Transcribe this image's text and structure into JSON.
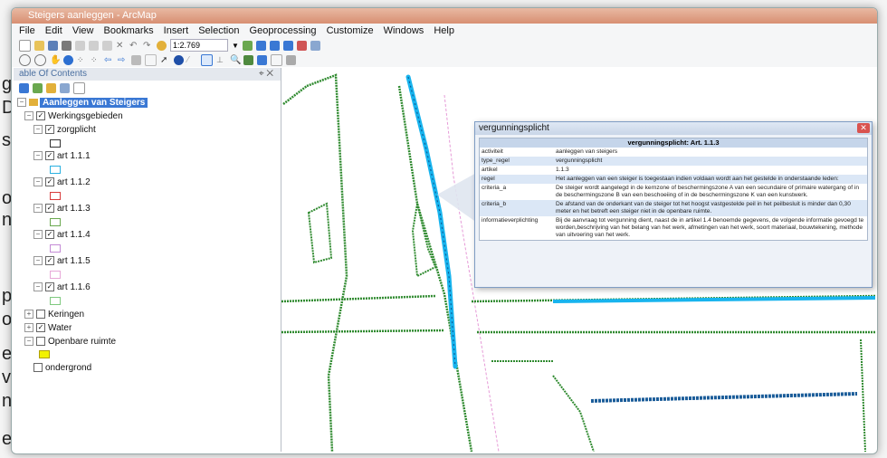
{
  "background": {
    "top_fragment": "g",
    "fragments": [
      "g",
      "Di",
      "s",
      "or",
      "n",
      "p",
      "of",
      "e",
      "v",
      "n",
      "e"
    ]
  },
  "window": {
    "title": "Steigers aanleggen - ArcMap"
  },
  "menu": [
    "File",
    "Edit",
    "View",
    "Bookmarks",
    "Insert",
    "Selection",
    "Geoprocessing",
    "Customize",
    "Windows",
    "Help"
  ],
  "toolbar": {
    "scale": "1:2.769"
  },
  "toc": {
    "title": "able Of Contents",
    "root": "Aanleggen van Steigers",
    "group": "Werkingsgebieden",
    "layers": [
      {
        "name": "zorgplicht",
        "color": "#333333"
      },
      {
        "name": "art 1.1.1",
        "color": "#2ab0e0"
      },
      {
        "name": "art 1.1.2",
        "color": "#d83a3a"
      },
      {
        "name": "art 1.1.3",
        "color": "#6aa84f"
      },
      {
        "name": "art 1.1.4",
        "color": "#c48bd6"
      },
      {
        "name": "art 1.1.5",
        "color": "#e7a8d8"
      },
      {
        "name": "art 1.1.6",
        "color": "#7fc97f"
      }
    ],
    "groups2": [
      "Keringen",
      "Water",
      "Openbare ruimte"
    ],
    "openbare_color": "#f2f200",
    "last": "ondergrond"
  },
  "popup": {
    "title": "vergunningsplicht",
    "header": "vergunningsplicht: Art. 1.1.3",
    "rows": [
      {
        "key": "activiteit",
        "value": "aanleggen van steigers"
      },
      {
        "key": "type_regel",
        "value": "vergunningsplicht"
      },
      {
        "key": "artikel",
        "value": "1.1.3"
      },
      {
        "key": "regel",
        "value": "Het aanleggen van een steiger is toegestaan indien voldaan wordt aan het gestelde in onderstaande leden:"
      },
      {
        "key": "criteria_a",
        "value": "De steiger wordt aangelegd in de kernzone of beschermingszone A van een secundaire of primaire watergang of in de beschermingszone B van een beschoeiing of in de beschermingszone K van een kunstwerk."
      },
      {
        "key": "criteria_b",
        "value": "De afstand van de onderkant van de steiger tot het hoogst vastgestelde peil in het peilbesluit is minder dan 0,30 meter en het betreft een steiger niet in de openbare ruimte."
      },
      {
        "key": "informatieverplichting",
        "value": "Bij de aanvraag tot vergunning dient, naast de in artikel 1.4 benoemde gegevens, de volgende informatie gevoegd te worden,beschrijving van het belang van het werk, afmetingen van het werk, soort materiaal, bouwtekening, methode van uitvoering van het werk."
      }
    ]
  },
  "colors": {
    "accent": "#3a78d4",
    "water": "#18b4ee",
    "hatch_green": "#2f8a2f",
    "boundary_pink": "#e69ad7"
  }
}
